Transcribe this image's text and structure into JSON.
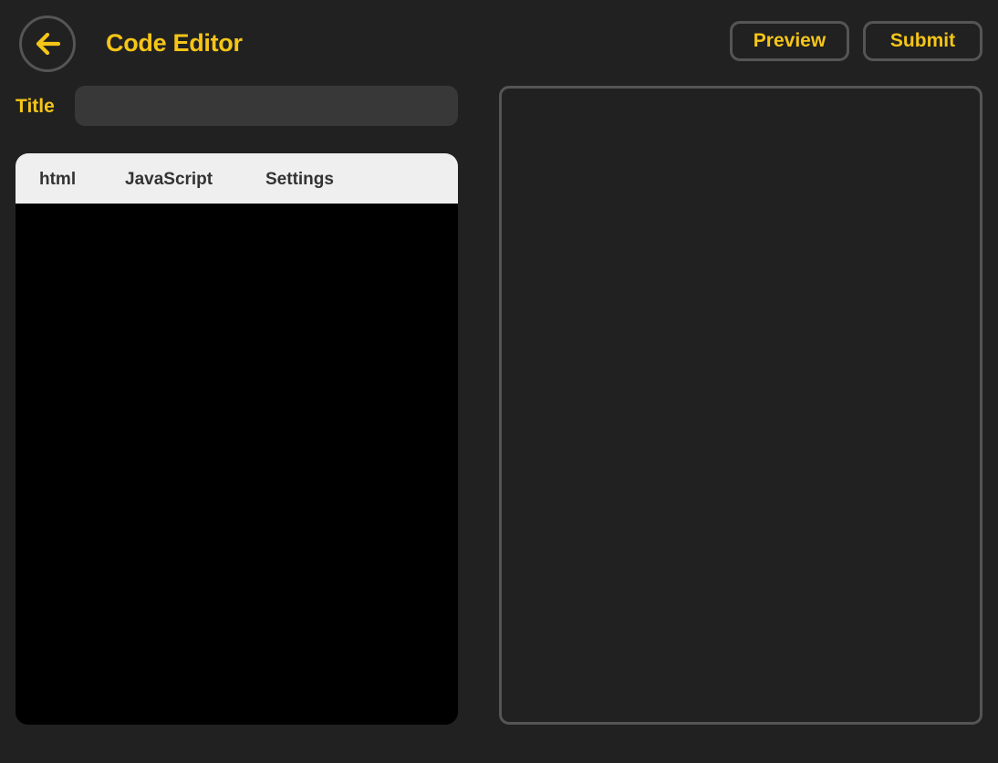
{
  "header": {
    "title": "Code Editor",
    "back_icon": "arrow-left-icon",
    "preview_label": "Preview",
    "submit_label": "Submit"
  },
  "form": {
    "title_label": "Title",
    "title_value": "",
    "title_placeholder": ""
  },
  "editor": {
    "tabs": [
      {
        "label": "html"
      },
      {
        "label": "JavaScript"
      },
      {
        "label": "Settings"
      }
    ],
    "code": ""
  },
  "colors": {
    "background": "#212121",
    "accent": "#f5c518",
    "border": "#555555",
    "input_bg": "#383838",
    "tabs_bg": "#efefef",
    "code_bg": "#000000"
  }
}
